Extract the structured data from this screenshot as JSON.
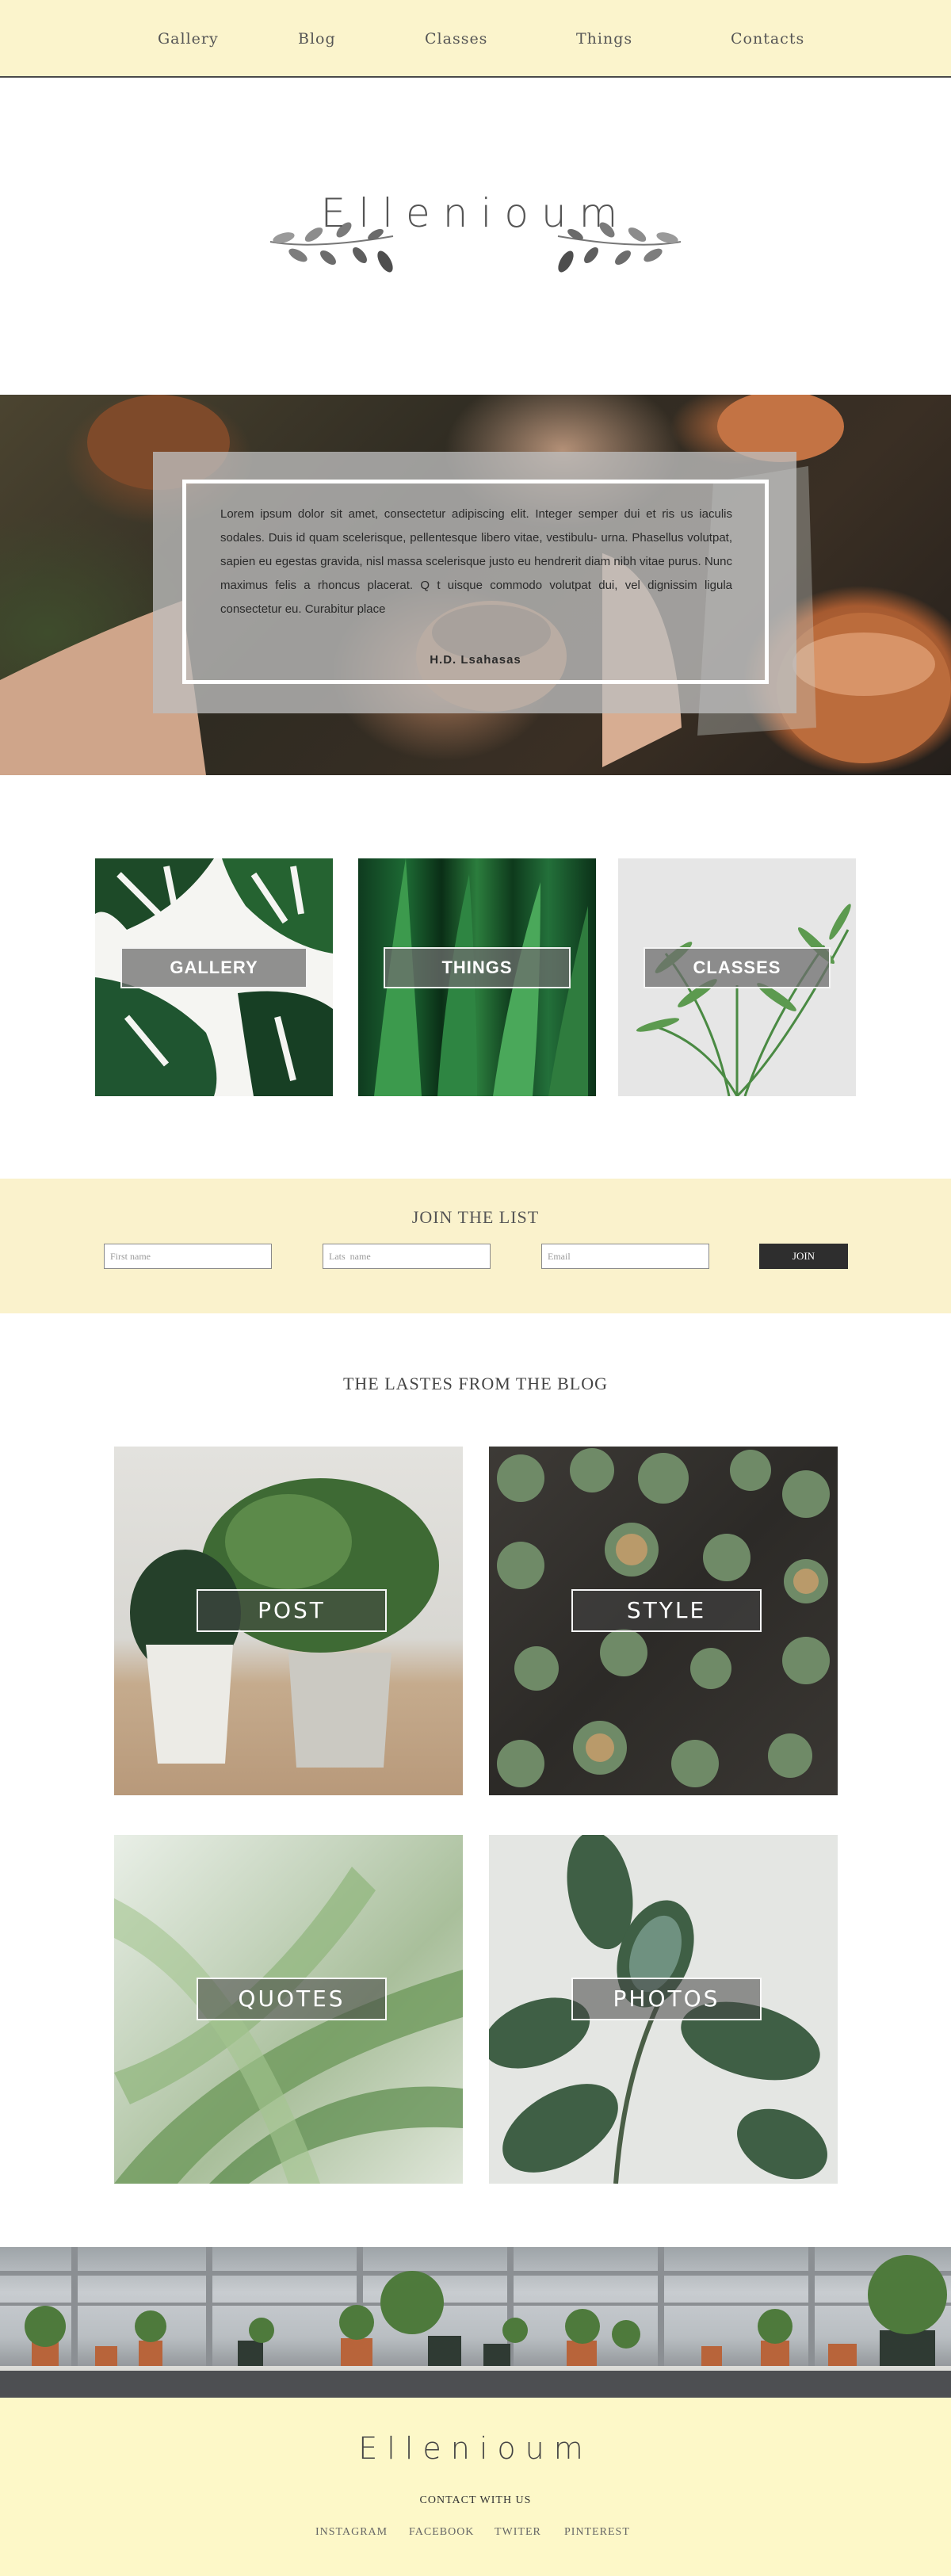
{
  "nav": {
    "items": [
      "Gallery",
      "Blog",
      "Classes",
      "Things",
      "Contacts"
    ]
  },
  "brand": {
    "name": "Ellenioum"
  },
  "hero": {
    "quote": "Lorem ipsum dolor sit amet, consectetur adipiscing elit. Integer semper dui et ris us iaculis sodales. Duis id quam scelerisque, pellentesque libero vitae, vestibulu- urna. Phasellus volutpat, sapien eu egestas gravida, nisl massa scelerisque justo eu hendrerit diam nibh vitae purus. Nunc maximus felis a rhoncus placerat. Q t uisque commodo volutpat dui, vel dignissim ligula consectetur eu. Curabitur place",
    "author": "H.D.  Lsahasas"
  },
  "tiles": [
    {
      "label": "GALLERY"
    },
    {
      "label": "THINGS"
    },
    {
      "label": "CLASSES"
    }
  ],
  "join": {
    "title": "JOIN THE LIST",
    "first_name_placeholder": "First name",
    "last_name_placeholder": "Lats  name",
    "email_placeholder": "Email",
    "button": "JOIN"
  },
  "blog": {
    "title": "THE LASTES FROM THE BLOG",
    "posts": [
      {
        "label": "POST"
      },
      {
        "label": "STYLE"
      },
      {
        "label": "QUOTES"
      },
      {
        "label": "PHOTOS"
      }
    ]
  },
  "footer": {
    "brand": "Ellenioum",
    "contact": "CONTACT WITH US",
    "social": [
      "INSTAGRAM",
      "FACEBOOK",
      "TWITER",
      "PINTEREST"
    ]
  },
  "colors": {
    "cream": "#fbf4cc",
    "footer_cream": "#fdf8c8",
    "dark_button": "#2e2e2e"
  }
}
